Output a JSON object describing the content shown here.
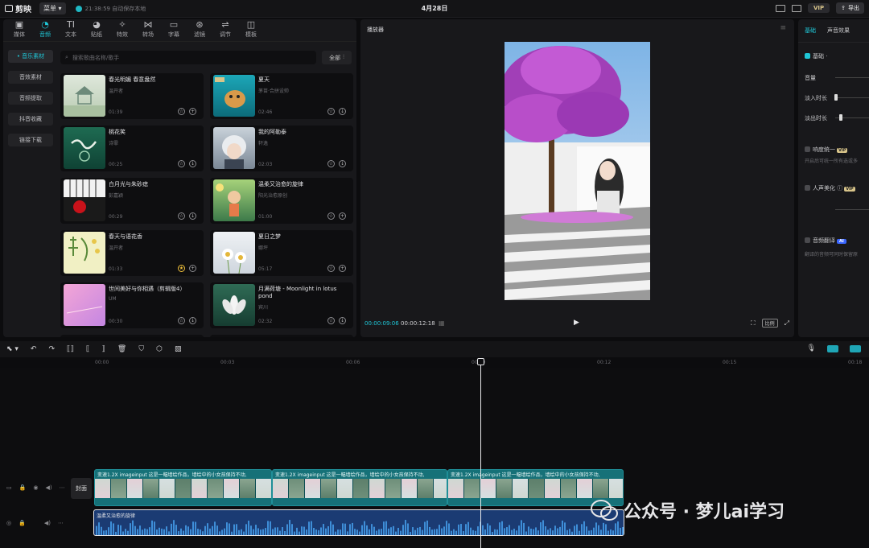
{
  "app": {
    "name": "剪映",
    "menu_label": "菜单",
    "autosave": "21:38:59 自动保存本地",
    "project_title": "4月28日",
    "vip_label": "VIP",
    "export_label": "导出"
  },
  "toolbar": [
    {
      "label": "媒体",
      "icon": "media-icon"
    },
    {
      "label": "音频",
      "icon": "audio-icon",
      "active": true
    },
    {
      "label": "文本",
      "icon": "text-icon"
    },
    {
      "label": "贴纸",
      "icon": "sticker-icon"
    },
    {
      "label": "特效",
      "icon": "effects-icon"
    },
    {
      "label": "转场",
      "icon": "transition-icon"
    },
    {
      "label": "字幕",
      "icon": "subtitle-icon"
    },
    {
      "label": "滤镜",
      "icon": "filter-icon"
    },
    {
      "label": "调节",
      "icon": "adjust-icon"
    },
    {
      "label": "模板",
      "icon": "template-icon"
    }
  ],
  "sidebar": [
    {
      "label": "• 音乐素材",
      "active": true
    },
    {
      "label": "音效素材"
    },
    {
      "label": "音频提取"
    },
    {
      "label": "抖音收藏"
    },
    {
      "label": "链接下载"
    }
  ],
  "search": {
    "placeholder": "搜索歌曲名称/歌手",
    "filter_label": "全部"
  },
  "songs": [
    {
      "title": "春光明媚 春意盎然",
      "artist": "温开者",
      "duration": "01:39",
      "thumb": "pavilion",
      "starred": false,
      "action": "+"
    },
    {
      "title": "夏天",
      "artist": "茅苗·合拼设帅",
      "duration": "02:46",
      "thumb": "dog",
      "starred": false,
      "action": "↓"
    },
    {
      "title": "桃花笑",
      "artist": "诗霏",
      "duration": "00:25",
      "thumb": "green",
      "starred": false,
      "action": "↓"
    },
    {
      "title": "我的阿勒泰",
      "artist": "轩逸",
      "duration": "02:03",
      "thumb": "anime",
      "starred": false,
      "action": "↓"
    },
    {
      "title": "白月光与朱砂痣",
      "artist": "彭嘉颖",
      "duration": "00:29",
      "thumb": "piano",
      "starred": false,
      "action": "↓"
    },
    {
      "title": "温柔又治愈的旋律",
      "artist": "阳光治愈原创",
      "duration": "01:00",
      "thumb": "garden",
      "starred": false,
      "action": "+"
    },
    {
      "title": "春天与语花香",
      "artist": "温开者",
      "duration": "01:33",
      "thumb": "poster",
      "starred": true,
      "action": "+"
    },
    {
      "title": "夏日之梦",
      "artist": "娜坪",
      "duration": "05:17",
      "thumb": "daisy",
      "starred": false,
      "action": "+"
    },
    {
      "title": "世间美好与你相遇（剪辑版4）",
      "artist": "UM",
      "duration": "00:30",
      "thumb": "pink",
      "starred": false,
      "action": "↓"
    },
    {
      "title": "月满荷塘 - Moonlight in lotus pond",
      "artist": "宾川",
      "duration": "02:32",
      "thumb": "lotus",
      "starred": false,
      "action": "↓"
    }
  ],
  "player": {
    "title": "播放器",
    "current_time": "00:00:09:06",
    "total_time": "00:00:12:18",
    "ratio_label": "比例"
  },
  "properties": {
    "tabs": [
      "基础",
      "声音效果"
    ],
    "basic_label": "基础",
    "volume": "音量",
    "fade_in": "淡入时长",
    "fade_out": "淡出时长",
    "loudness": "响度统一",
    "loudness_desc": "开启后可统一所有选或多",
    "voice": "人声美化",
    "translate": "音频翻译",
    "translate_desc": "翻译的音频可同时保留原",
    "vip": "VIP",
    "ai": "AI"
  },
  "timeline": {
    "ruler": [
      "00:00",
      "00:03",
      "00:06",
      "00:09",
      "00:12",
      "00:15",
      "00:18"
    ],
    "cover_label": "封面",
    "clips": [
      {
        "label": "变速1.2X  imageinput 这是一幅墙绘作品，墙绘中的小女孩保持不动,"
      },
      {
        "label": "变速1.2X  imageinput 这是一幅墙绘作品，墙绘中的小女孩保持不动,"
      },
      {
        "label": "变速1.2X  imageinput 这是一幅墙绘作品，墙绘中的小女孩保持不动,"
      }
    ],
    "audio_label": "温柔又治愈的旋律"
  },
  "watermark": {
    "text": "公众号 · 梦儿ai学习"
  }
}
